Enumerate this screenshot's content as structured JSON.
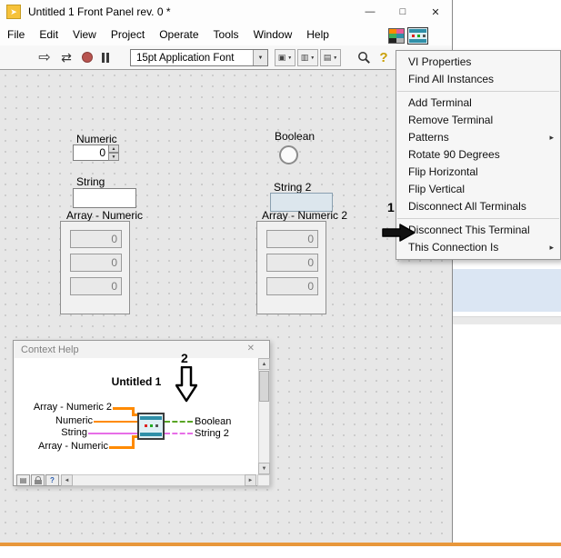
{
  "window": {
    "title": "Untitled 1 Front Panel rev. 0 *",
    "menu_items": [
      "File",
      "Edit",
      "View",
      "Project",
      "Operate",
      "Tools",
      "Window",
      "Help"
    ],
    "titlebar_icons": {
      "minimize": "—",
      "maximize": "□",
      "close": "✕"
    }
  },
  "toolbar": {
    "font_selector": "15pt Application Font"
  },
  "icons": {
    "run": "⇨",
    "run_continuous": "⇄",
    "dropdown": "▼",
    "up": "▲",
    "down": "▼",
    "left": "◄",
    "right": "►",
    "align": "▣",
    "distribute": "▥",
    "reorder": "▤",
    "help": "?",
    "close": "✕",
    "optional_terminals": "▤"
  },
  "context_menu": {
    "submenu_arrow": "▸",
    "items": [
      {
        "label": "VI Properties"
      },
      {
        "label": "Find All Instances"
      },
      {
        "label": "Add Terminal"
      },
      {
        "label": "Remove Terminal"
      },
      {
        "label": "Patterns",
        "submenu": true
      },
      {
        "label": "Rotate 90 Degrees"
      },
      {
        "label": "Flip Horizontal"
      },
      {
        "label": "Flip Vertical"
      },
      {
        "label": "Disconnect All Terminals"
      },
      {
        "label": "Disconnect This Terminal"
      },
      {
        "label": "This Connection Is",
        "submenu": true
      }
    ]
  },
  "panel": {
    "numeric": {
      "label": "Numeric",
      "value": "0"
    },
    "boolean": {
      "label": "Boolean"
    },
    "string": {
      "label": "String",
      "value": ""
    },
    "string2": {
      "label": "String 2",
      "value": ""
    },
    "array_numeric": {
      "label": "Array - Numeric",
      "values": [
        "0",
        "0",
        "0"
      ]
    },
    "array_numeric2": {
      "label": "Array - Numeric 2",
      "values": [
        "0",
        "0",
        "0"
      ]
    }
  },
  "context_help": {
    "title": "Context Help",
    "vi_name": "Untitled 1",
    "left_terminals": [
      "Array - Numeric 2",
      "Numeric",
      "String",
      "Array - Numeric"
    ],
    "right_terminals": [
      "Boolean",
      "String 2"
    ],
    "wire_colors": {
      "numeric": "#ff8a00",
      "string": "#e76ee7",
      "boolean": "#59a524"
    }
  },
  "annotations": {
    "label1": "1",
    "label2": "2"
  }
}
